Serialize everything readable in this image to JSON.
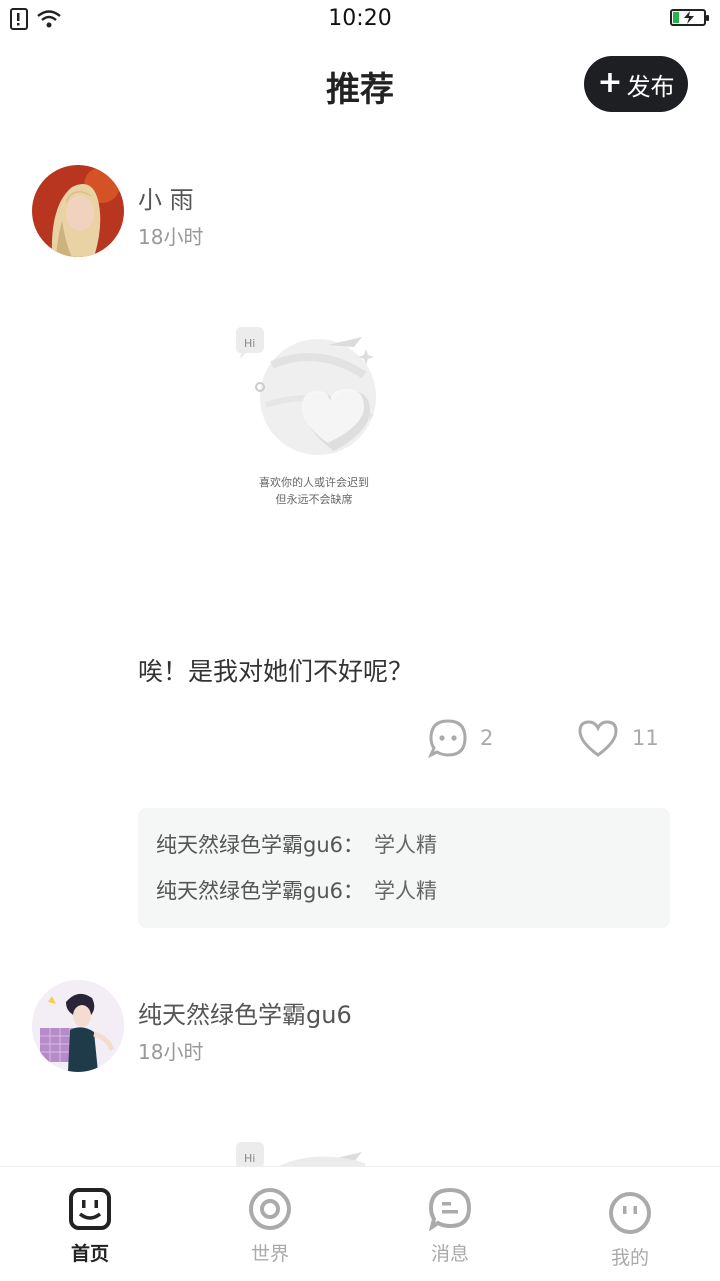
{
  "status_bar": {
    "time": "10:20"
  },
  "header": {
    "title": "推荐",
    "publish_label": "发布"
  },
  "posts": [
    {
      "author": "小 雨",
      "time": "18小时",
      "placeholder_caption_1": "喜欢你的人或许会迟到",
      "placeholder_caption_2": "但永远不会缺席",
      "placeholder_bubble": "Hi",
      "content": "唉！是我对她们不好呢？",
      "comment_count": "2",
      "like_count": "11",
      "comments": [
        {
          "name": "纯天然绿色学霸gu6：",
          "text": "学人精"
        },
        {
          "name": "纯天然绿色学霸gu6：",
          "text": "学人精"
        }
      ]
    },
    {
      "author": "纯天然绿色学霸gu6",
      "time": "18小时",
      "placeholder_bubble": "Hi"
    }
  ],
  "tabs": [
    {
      "label": "首页",
      "icon": "home-face-icon",
      "active": true
    },
    {
      "label": "世界",
      "icon": "world-ring-icon",
      "active": false
    },
    {
      "label": "消息",
      "icon": "message-bubble-icon",
      "active": false
    },
    {
      "label": "我的",
      "icon": "profile-face-icon",
      "active": false
    }
  ],
  "colors": {
    "publish_bg": "#1e1f23",
    "comment_bg": "#f5f6f6",
    "battery": "#2bb24c"
  }
}
